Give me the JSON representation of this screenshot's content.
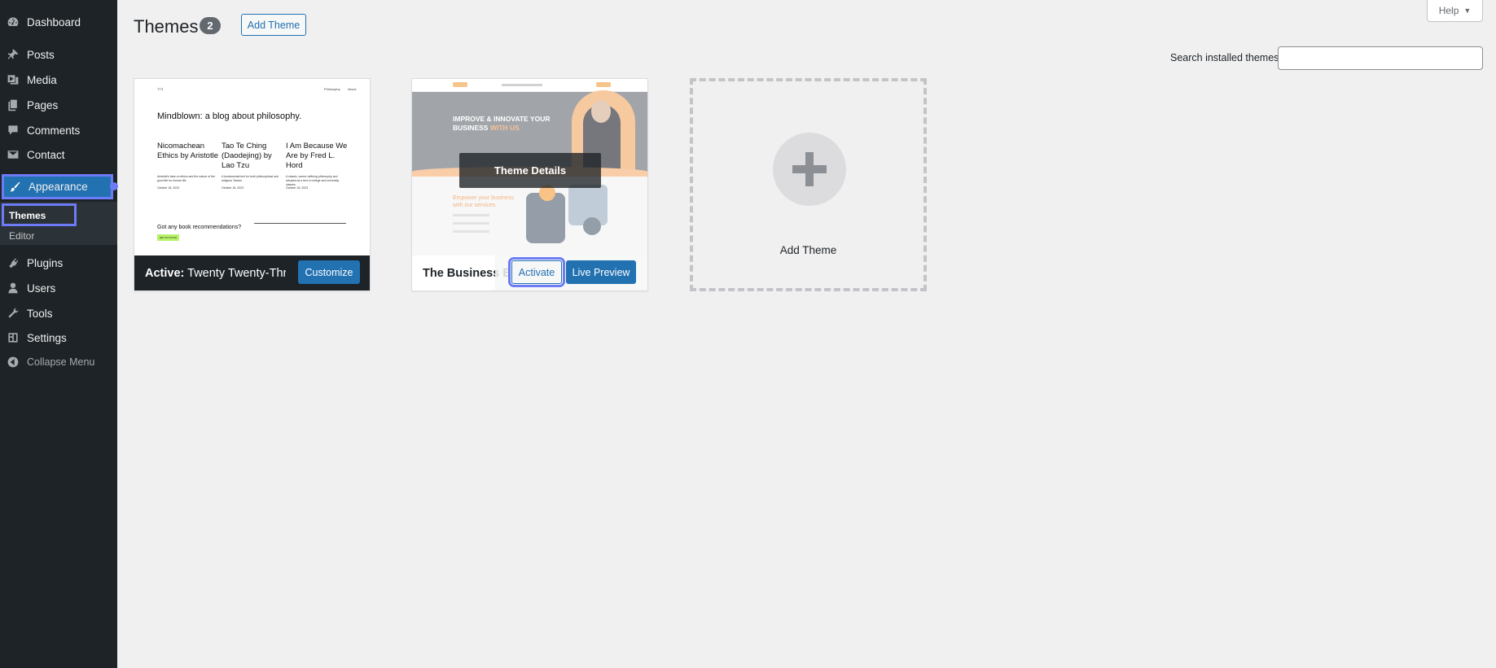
{
  "sidebar": {
    "items": [
      {
        "label": "Dashboard",
        "icon": "dashboard-icon"
      },
      {
        "label": "Posts",
        "icon": "pin-icon"
      },
      {
        "label": "Media",
        "icon": "media-icon"
      },
      {
        "label": "Pages",
        "icon": "pages-icon"
      },
      {
        "label": "Comments",
        "icon": "comment-icon"
      },
      {
        "label": "Contact",
        "icon": "mail-icon"
      },
      {
        "label": "Appearance",
        "icon": "paintbrush-icon"
      },
      {
        "label": "Plugins",
        "icon": "plugin-icon"
      },
      {
        "label": "Users",
        "icon": "user-icon"
      },
      {
        "label": "Tools",
        "icon": "wrench-icon"
      },
      {
        "label": "Settings",
        "icon": "settings-icon"
      }
    ],
    "submenu": [
      {
        "label": "Themes"
      },
      {
        "label": "Editor"
      }
    ],
    "collapse_label": "Collapse Menu"
  },
  "header": {
    "title": "Themes",
    "count": "2",
    "add_theme_label": "Add Theme",
    "help_label": "Help"
  },
  "search": {
    "label": "Search installed themes",
    "value": ""
  },
  "themes": [
    {
      "active_prefix": "Active:",
      "name": "Twenty Twenty-Three",
      "button": "Customize",
      "preview": {
        "logo": "TT3",
        "nav": [
          "Philosophy",
          "About"
        ],
        "headline": "Mindblown: a blog about philosophy.",
        "posts": [
          {
            "title": "Nicomachean Ethics by Aristotle",
            "excerpt": "Aristotle's take on ethics and the nature of the good life for human life.",
            "date": "October 18, 2023"
          },
          {
            "title": "Tao Te Ching (Daodejing) by Lao Tzu",
            "excerpt": "A fundamental text for both philosophical and religious Taoism.",
            "date": "October 18, 2023"
          },
          {
            "title": "I Am Because We Are by Fred L. Hord",
            "excerpt": "A classic, career-defining philosophy and adopted as a text in college and university classes.",
            "date": "October 18, 2023"
          }
        ],
        "cta_text": "Got any book recommendations?",
        "cta_button": "GET IN TOUCH"
      }
    },
    {
      "name": "The Business Blog",
      "details_label": "Theme Details",
      "activate_label": "Activate",
      "preview_label": "Live Preview",
      "preview": {
        "hero_line1": "IMPROVE & INNOVATE YOUR",
        "hero_line2": "BUSINESS",
        "hero_line2_accent": "WITH US",
        "section_title": "Empower your business with our services"
      }
    }
  ],
  "add_card": {
    "label": "Add Theme"
  },
  "colors": {
    "sidebar_bg": "#1d2327",
    "accent": "#2271b1",
    "highlight": "#6d7cf6",
    "page_bg": "#f0f0f1"
  }
}
